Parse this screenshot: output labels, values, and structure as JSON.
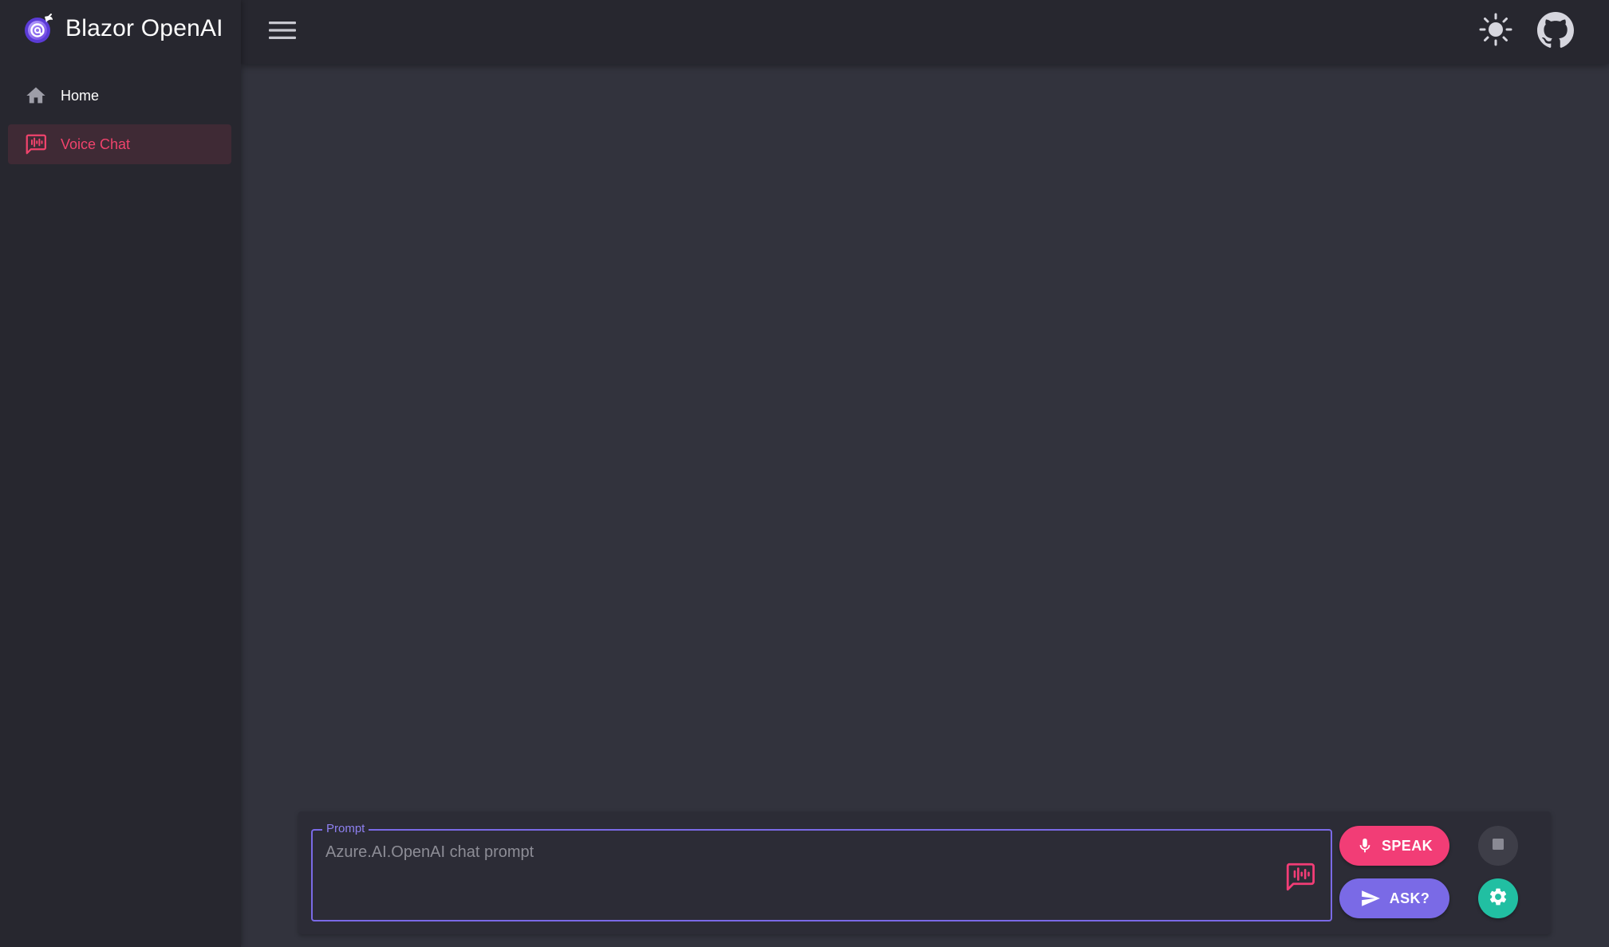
{
  "app": {
    "title": "Blazor OpenAI"
  },
  "sidebar": {
    "items": [
      {
        "label": "Home",
        "icon": "home-icon",
        "active": false
      },
      {
        "label": "Voice Chat",
        "icon": "voice-chat-icon",
        "active": true
      }
    ]
  },
  "topbar": {
    "menu_icon": "hamburger-menu-icon",
    "theme_icon": "sun-icon",
    "github_icon": "github-icon"
  },
  "prompt": {
    "label": "Prompt",
    "value": "",
    "placeholder": "Azure.AI.OpenAI chat prompt"
  },
  "actions": {
    "speak_label": "SPEAK",
    "ask_label": "ASK?",
    "stop_icon": "stop-icon",
    "settings_icon": "gear-icon"
  },
  "colors": {
    "accent_pink": "#f23d76",
    "accent_purple": "#7a6ae6",
    "accent_teal": "#21bfa2",
    "active_nav_text": "#f0436c",
    "sidebar_bg": "#27272f",
    "main_bg": "#32333d"
  }
}
